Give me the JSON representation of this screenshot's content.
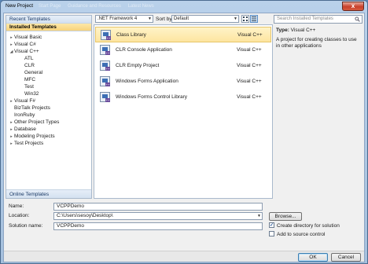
{
  "window": {
    "title": "New Project",
    "background_tabs": [
      "Start Page",
      "Guidance and Resources",
      "Latest News"
    ],
    "close_glyph": "x"
  },
  "left_panel": {
    "recent_templates": "Recent Templates",
    "installed_templates": "Installed Templates",
    "online_templates": "Online Templates",
    "tree": [
      {
        "label": "Visual Basic",
        "indent": 1,
        "expander": "▸"
      },
      {
        "label": "Visual C#",
        "indent": 1,
        "expander": "▸"
      },
      {
        "label": "Visual C++",
        "indent": 1,
        "expander": "◢"
      },
      {
        "label": "ATL",
        "indent": 2,
        "expander": ""
      },
      {
        "label": "CLR",
        "indent": 2,
        "expander": ""
      },
      {
        "label": "General",
        "indent": 2,
        "expander": ""
      },
      {
        "label": "MFC",
        "indent": 2,
        "expander": ""
      },
      {
        "label": "Test",
        "indent": 2,
        "expander": ""
      },
      {
        "label": "Win32",
        "indent": 2,
        "expander": ""
      },
      {
        "label": "Visual F#",
        "indent": 1,
        "expander": "▸"
      },
      {
        "label": "BizTalk Projects",
        "indent": 1,
        "expander": ""
      },
      {
        "label": "IronRuby",
        "indent": 1,
        "expander": ""
      },
      {
        "label": "Other Project Types",
        "indent": 1,
        "expander": "▸"
      },
      {
        "label": "Database",
        "indent": 1,
        "expander": "▸"
      },
      {
        "label": "Modeling Projects",
        "indent": 1,
        "expander": "▸"
      },
      {
        "label": "Test Projects",
        "indent": 1,
        "expander": "▸"
      }
    ]
  },
  "toolbar": {
    "framework": ".NET Framework 4",
    "sort_by_label": "Sort by:",
    "sort_by_value": "Default"
  },
  "search": {
    "placeholder": "Search Installed Templates"
  },
  "templates": [
    {
      "name": "Class Library",
      "lang": "Visual C++",
      "selected": true,
      "icon": "class-library-icon"
    },
    {
      "name": "CLR Console Application",
      "lang": "Visual C++",
      "selected": false,
      "icon": "console-app-icon"
    },
    {
      "name": "CLR Empty Project",
      "lang": "Visual C++",
      "selected": false,
      "icon": "empty-project-icon"
    },
    {
      "name": "Windows Forms Application",
      "lang": "Visual C++",
      "selected": false,
      "icon": "windows-forms-icon"
    },
    {
      "name": "Windows Forms Control Library",
      "lang": "Visual C++",
      "selected": false,
      "icon": "control-library-icon"
    }
  ],
  "info": {
    "type_label": "Type:",
    "type_value": "Visual C++",
    "description": "A project for creating classes to use in other applications"
  },
  "form": {
    "name_label": "Name:",
    "name_value": "VCPPDemo",
    "location_label": "Location:",
    "location_value": "C:\\Users\\sesoy\\Desktop\\",
    "solution_name_label": "Solution name:",
    "solution_name_value": "VCPPDemo",
    "browse_label": "Browse...",
    "create_directory_label": "Create directory for solution",
    "create_directory_checked": true,
    "source_control_label": "Add to source control",
    "source_control_checked": false,
    "ok_label": "OK",
    "cancel_label": "Cancel"
  }
}
